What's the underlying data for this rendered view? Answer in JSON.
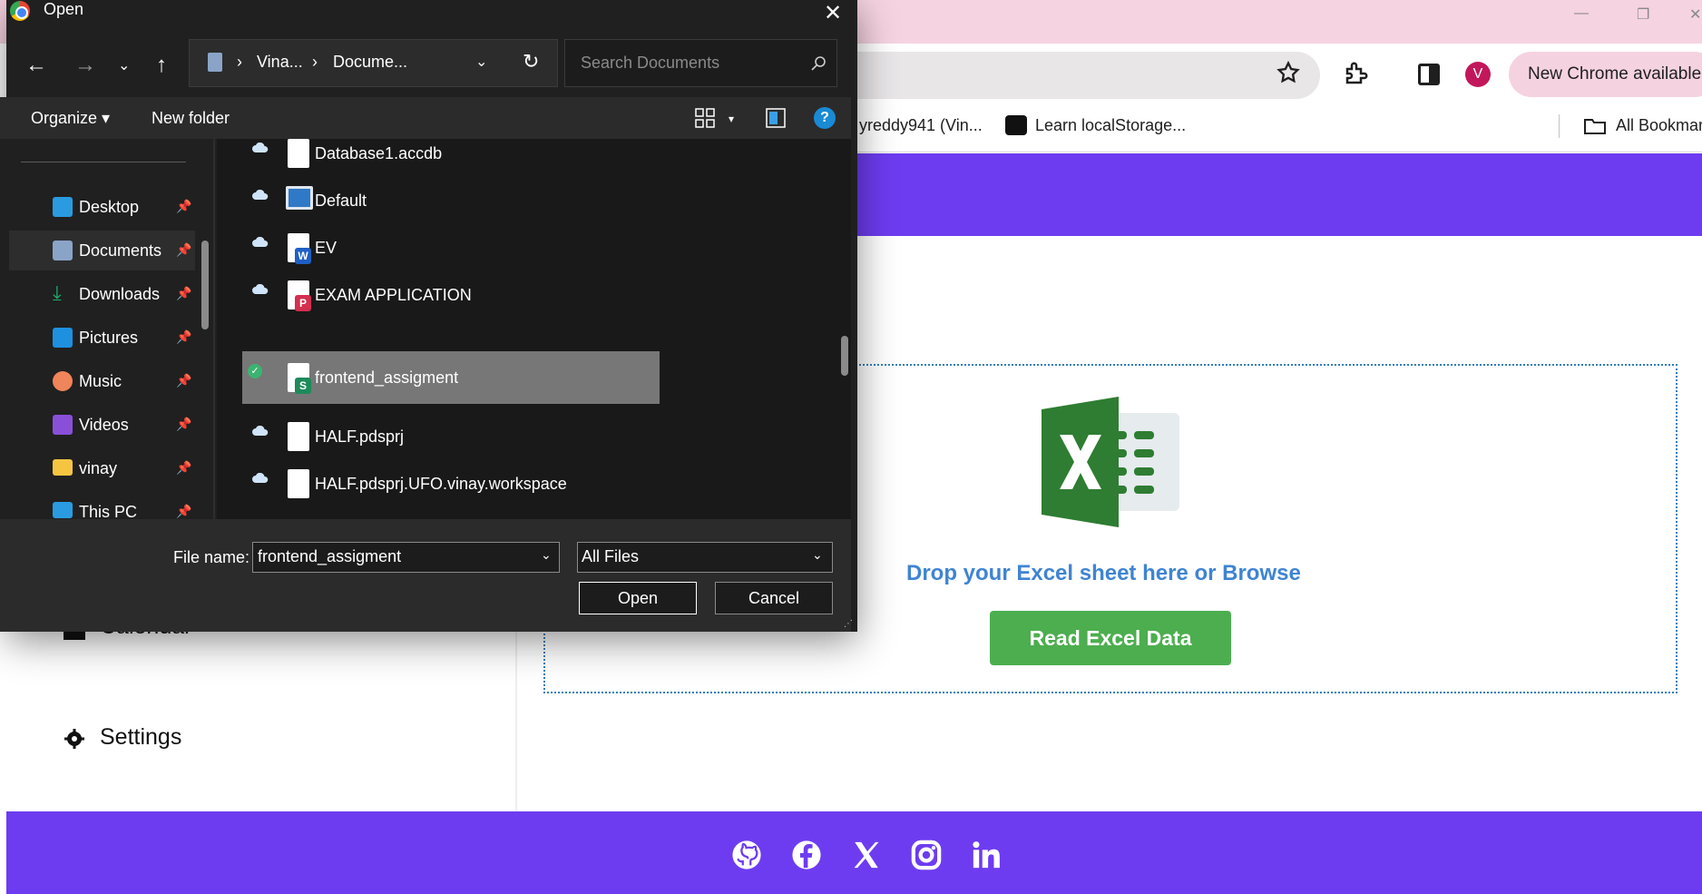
{
  "browser": {
    "update_label": "New Chrome available",
    "profile_initial": "V",
    "bookmarks": [
      {
        "label": "yreddy941 (Vin..."
      },
      {
        "label": "Learn localStorage..."
      },
      {
        "label": "All Bookmar"
      }
    ]
  },
  "page": {
    "sidebar": {
      "partial_item_label": "Calendar",
      "settings_label": "Settings"
    },
    "drop_text": "Drop your Excel sheet here or Browse",
    "read_button_label": "Read Excel Data",
    "colors": {
      "header": "#6d3cf0",
      "button": "#4cae4f",
      "link": "#3f84d2"
    }
  },
  "dialog": {
    "title": "Open",
    "breadcrumb": [
      "Vina...",
      "Docume..."
    ],
    "search_placeholder": "Search Documents",
    "organize_label": "Organize",
    "new_folder_label": "New folder",
    "nav_items": [
      {
        "label": "Desktop"
      },
      {
        "label": "Documents"
      },
      {
        "label": "Downloads"
      },
      {
        "label": "Pictures"
      },
      {
        "label": "Music"
      },
      {
        "label": "Videos"
      },
      {
        "label": "vinay"
      },
      {
        "label": "This PC"
      }
    ],
    "files": [
      {
        "name": "Database1.accdb",
        "icon": "generic-file-icon"
      },
      {
        "name": "Default",
        "icon": "computer-shortcut-icon"
      },
      {
        "name": "EV",
        "icon": "word-file-icon"
      },
      {
        "name": "EXAM APPLICATION",
        "icon": "pdf-file-icon"
      },
      {
        "name": "frontend_assigment",
        "icon": "sheet-file-icon"
      },
      {
        "name": "HALF.pdsprj",
        "icon": "generic-file-icon"
      },
      {
        "name": "HALF.pdsprj.UFO.vinay.workspace",
        "icon": "generic-file-icon"
      }
    ],
    "file_name_label": "File name:",
    "file_name_value": "frontend_assigment",
    "file_type_value": "All Files",
    "open_label": "Open",
    "cancel_label": "Cancel"
  }
}
